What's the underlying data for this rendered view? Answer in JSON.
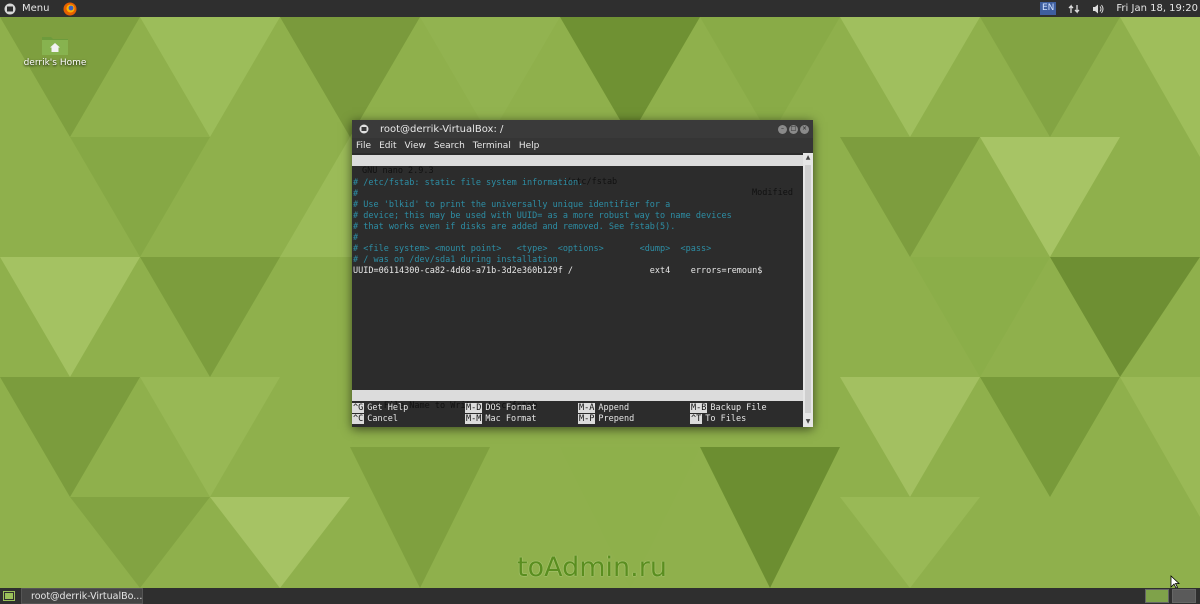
{
  "top_panel": {
    "menu_label": "Menu",
    "language": "EN",
    "clock": "Fri Jan 18, 19:20"
  },
  "desktop": {
    "home_icon_label": "derrik's Home"
  },
  "terminal": {
    "title": "root@derrik-VirtualBox: /",
    "menu": [
      "File",
      "Edit",
      "View",
      "Search",
      "Terminal",
      "Help"
    ],
    "nano_header": {
      "version": "GNU nano 2.9.3",
      "file": "/etc/fstab",
      "status": "Modified"
    },
    "lines": [
      {
        "text": "# /etc/fstab: static file system information.",
        "kind": "comment"
      },
      {
        "text": "#",
        "kind": "comment"
      },
      {
        "text": "# Use 'blkid' to print the universally unique identifier for a",
        "kind": "comment"
      },
      {
        "text": "# device; this may be used with UUID= as a more robust way to name devices",
        "kind": "comment"
      },
      {
        "text": "# that works even if disks are added and removed. See fstab(5).",
        "kind": "comment"
      },
      {
        "text": "#",
        "kind": "comment"
      },
      {
        "text": "# <file system> <mount point>   <type>  <options>       <dump>  <pass>",
        "kind": "comment"
      },
      {
        "text": "# / was on /dev/sda1 during installation",
        "kind": "comment"
      },
      {
        "text": "UUID=06114300-ca82-4d68-a71b-3d2e360b129f /               ext4    errors=remoun$",
        "kind": "code"
      }
    ],
    "prompt": "File Name to Write: /etc/fstab",
    "shortcuts_row1": [
      {
        "key": "^G",
        "label": "Get Help"
      },
      {
        "key": "M-D",
        "label": "DOS Format"
      },
      {
        "key": "M-A",
        "label": "Append"
      },
      {
        "key": "M-B",
        "label": "Backup File"
      }
    ],
    "shortcuts_row2": [
      {
        "key": "^C",
        "label": "Cancel"
      },
      {
        "key": "M-M",
        "label": "Mac Format"
      },
      {
        "key": "M-P",
        "label": "Prepend"
      },
      {
        "key": "^T",
        "label": "To Files"
      }
    ]
  },
  "bottom_panel": {
    "task_label": "root@derrik-VirtualBo..."
  },
  "watermark": "toAdmin.ru",
  "colors": {
    "comment": "#2d8ea5",
    "panel": "#2f2f2f",
    "accent_green": "#7fa24a"
  }
}
